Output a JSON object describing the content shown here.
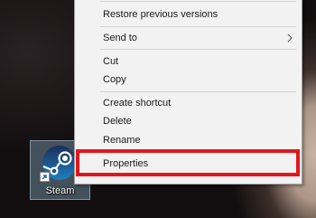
{
  "desktop": {
    "icon_label": "Steam",
    "icon_name": "steam-icon"
  },
  "context_menu": {
    "items": [
      {
        "label": "Restore previous versions"
      },
      {
        "label": "Send to",
        "has_submenu": true
      },
      {
        "label": "Cut"
      },
      {
        "label": "Copy"
      },
      {
        "label": "Create shortcut"
      },
      {
        "label": "Delete"
      },
      {
        "label": "Rename"
      },
      {
        "label": "Properties",
        "highlighted": true
      }
    ]
  },
  "colors": {
    "menu_background": "#f2f2f2",
    "highlight_border": "#e3161f",
    "icon_selection": "#a0cdeb"
  }
}
